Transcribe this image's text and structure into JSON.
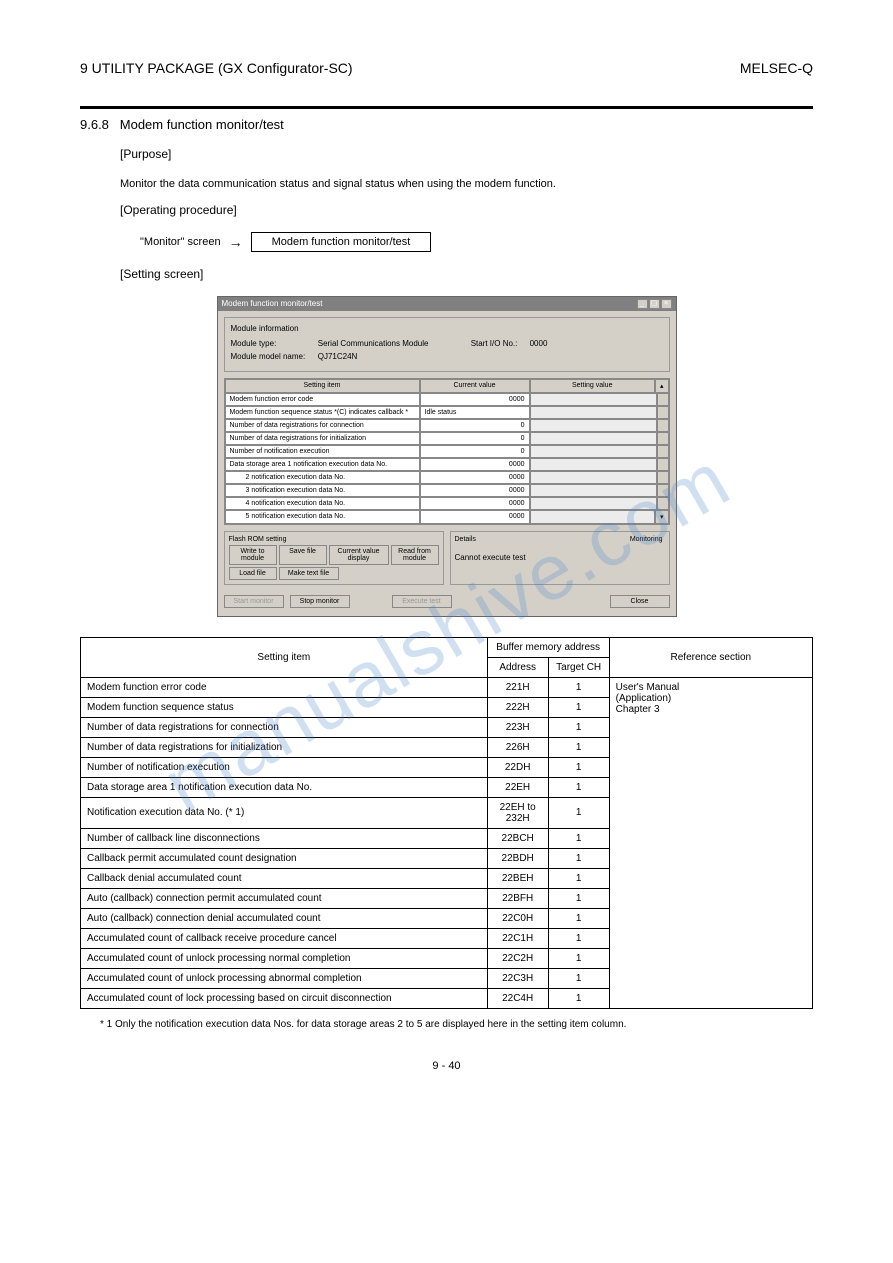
{
  "header": {
    "left": "9   UTILITY PACKAGE (GX Configurator-SC)",
    "right": "MELSEC-Q"
  },
  "section": {
    "number": "9.6.8",
    "title": "Modem function monitor/test",
    "subtitle": "[Purpose]",
    "body": "Monitor the data communication status and signal status when using the modem function.",
    "opproc": "[Operating procedure]",
    "step_label": "\"Monitor\" screen",
    "arrow": "→",
    "step_box": "Modem function monitor/test",
    "setscreen": "[Setting screen]"
  },
  "dialog": {
    "title": "Modem function monitor/test",
    "modinfo_title": "Module information",
    "modtype_lbl": "Module type:",
    "modtype_val": "Serial Communications Module",
    "startio_lbl": "Start I/O No.:",
    "startio_val": "0000",
    "modname_lbl": "Module model name:",
    "modname_val": "QJ71C24N",
    "columns": {
      "setting": "Setting item",
      "current": "Current value",
      "settingval": "Setting value"
    },
    "rows": [
      {
        "label": "Modem function error code",
        "value": "0000",
        "left": false
      },
      {
        "label": "Modem function sequence status\n*(C) indicates callback *",
        "value": "Idle status",
        "left": true
      },
      {
        "label": "Number of data registrations for connection",
        "value": "0",
        "left": false
      },
      {
        "label": "Number of data registrations for initialization",
        "value": "0",
        "left": false
      },
      {
        "label": "Number of notification execution",
        "value": "0",
        "left": false
      },
      {
        "label": "Data storage area 1 notification execution data No.",
        "value": "0000",
        "left": false,
        "merged": true
      },
      {
        "label": "2 notification execution data No.",
        "value": "0000",
        "indent": true
      },
      {
        "label": "3 notification execution data No.",
        "value": "0000",
        "indent": true
      },
      {
        "label": "4 notification execution data No.",
        "value": "0000",
        "indent": true
      },
      {
        "label": "5 notification execution data No.",
        "value": "0000",
        "indent": true
      }
    ],
    "flash_title": "Flash ROM setting",
    "btns": {
      "write": "Write to module",
      "save": "Save file",
      "curval": "Current value display",
      "read": "Read from module",
      "load": "Load file",
      "maketext": "Make text file"
    },
    "details_title": "Details",
    "details_body": "Cannot execute test",
    "monitoring": "Monitoring",
    "footer": {
      "start": "Start monitor",
      "stop": "Stop monitor",
      "execute": "Execute test",
      "close": "Close"
    }
  },
  "table": {
    "head": {
      "setting": "Setting item",
      "buf": "Buffer memory address",
      "addr": "Address",
      "ch": "Target CH",
      "ref": "Reference section"
    },
    "rows": [
      {
        "item": "Modem function error code",
        "addr": "221H",
        "ch": "1",
        "ref": "User's Manual\n(Application)\nChapter 3"
      },
      {
        "item": "Modem function sequence status",
        "addr": "222H",
        "ch": "1"
      },
      {
        "item": "Number of data registrations for connection",
        "addr": "223H",
        "ch": "1"
      },
      {
        "item": "Number of data registrations for initialization",
        "addr": "226H",
        "ch": "1"
      },
      {
        "item": "Number of notification execution",
        "addr": "22DH",
        "ch": "1"
      },
      {
        "item": "Data storage area 1 notification execution data No.",
        "addr": "22EH",
        "ch": "1"
      },
      {
        "item": "Notification execution data No. (* 1)",
        "addr": "22EH to 232H",
        "ch": "1"
      },
      {
        "item": "Number of callback line disconnections",
        "addr": "22BCH",
        "ch": "1"
      },
      {
        "item": "Callback permit accumulated count designation",
        "addr": "22BDH",
        "ch": "1"
      },
      {
        "item": "Callback denial accumulated count",
        "addr": "22BEH",
        "ch": "1"
      },
      {
        "item": "Auto (callback) connection permit accumulated count",
        "addr": "22BFH",
        "ch": "1"
      },
      {
        "item": "Auto (callback) connection denial accumulated count",
        "addr": "22C0H",
        "ch": "1"
      },
      {
        "item": "Accumulated count of callback receive procedure cancel",
        "addr": "22C1H",
        "ch": "1"
      },
      {
        "item": "Accumulated count of unlock processing normal completion",
        "addr": "22C2H",
        "ch": "1"
      },
      {
        "item": "Accumulated count of unlock processing abnormal completion",
        "addr": "22C3H",
        "ch": "1"
      },
      {
        "item": "Accumulated count of lock processing based on circuit disconnection",
        "addr": "22C4H",
        "ch": "1"
      }
    ],
    "note": "* 1   Only the notification execution data Nos. for data storage areas 2 to 5 are displayed here in the setting item column."
  },
  "pagenum": "9 - 40",
  "watermark": "manualshive.com"
}
